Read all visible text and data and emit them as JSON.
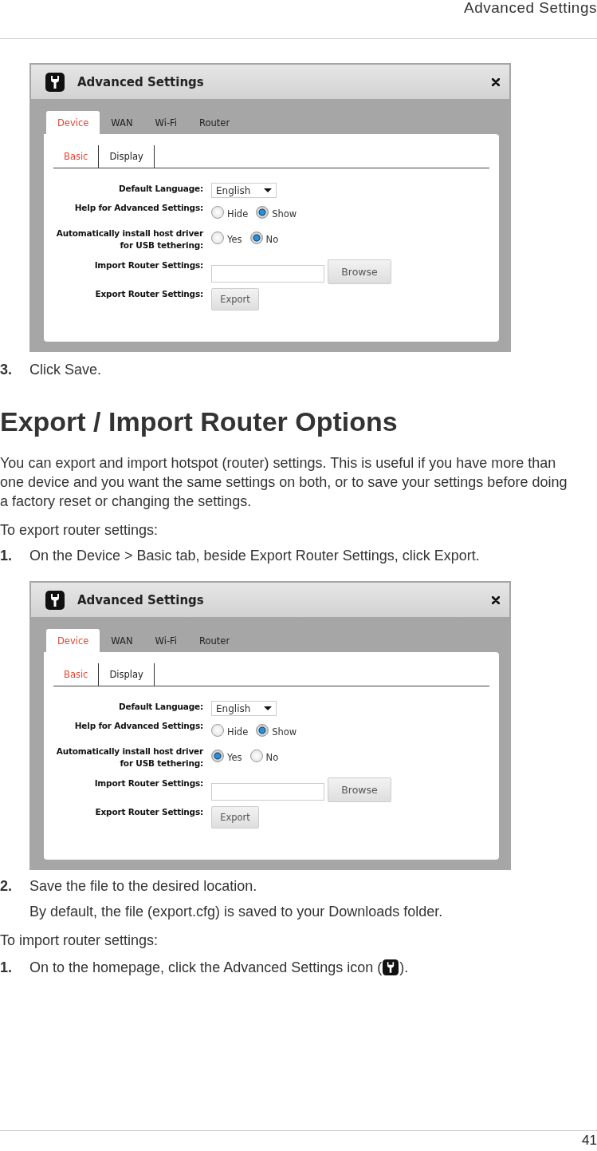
{
  "header": {
    "title": "Advanced Settings"
  },
  "content": [
    {
      "kind": "screenshot",
      "title": "Advanced Settings",
      "tabs": [
        {
          "label": "Device",
          "selected": true
        },
        {
          "label": "WAN",
          "selected": false
        },
        {
          "label": "Wi-Fi",
          "selected": false
        },
        {
          "label": "Router",
          "selected": false
        }
      ],
      "subtabs": [
        {
          "label": "Basic",
          "selected": true
        },
        {
          "label": "Display",
          "selected": false
        }
      ],
      "fields": [
        {
          "kind": "select",
          "label": "Default Language:",
          "value": "English"
        },
        {
          "kind": "radio",
          "label": "Help for Advanced Settings:",
          "options": [
            {
              "label": "Hide",
              "selected": false
            },
            {
              "label": "Show",
              "selected": true
            }
          ]
        },
        {
          "kind": "radio",
          "label": "Automatically install host driver\nfor USB tethering:",
          "options": [
            {
              "label": "Yes",
              "selected": false
            },
            {
              "label": "No",
              "selected": true
            }
          ]
        },
        {
          "kind": "file",
          "label": "Import Router Settings:",
          "button": "Browse"
        },
        {
          "kind": "button",
          "label": "Export Router Settings:",
          "button": "Export"
        }
      ]
    },
    {
      "kind": "step",
      "number": "3.",
      "text": [
        "Click Save."
      ]
    },
    {
      "kind": "heading",
      "text": "Export / Import Router Options"
    },
    {
      "kind": "paragraph",
      "text": "You can export and import hotspot (router) settings. This is useful if you have more than one device and you want the same settings on both, or to save your settings before doing a factory reset or changing the settings."
    },
    {
      "kind": "paragraph",
      "text": "To export router settings:"
    },
    {
      "kind": "step",
      "number": "1.",
      "text": [
        "On the Device > Basic tab, beside Export Router Settings, click Export."
      ]
    },
    {
      "kind": "screenshot",
      "title": "Advanced Settings",
      "tabs": [
        {
          "label": "Device",
          "selected": true
        },
        {
          "label": "WAN",
          "selected": false
        },
        {
          "label": "Wi-Fi",
          "selected": false
        },
        {
          "label": "Router",
          "selected": false
        }
      ],
      "subtabs": [
        {
          "label": "Basic",
          "selected": true
        },
        {
          "label": "Display",
          "selected": false
        }
      ],
      "fields": [
        {
          "kind": "select",
          "label": "Default Language:",
          "value": "English"
        },
        {
          "kind": "radio",
          "label": "Help for Advanced Settings:",
          "options": [
            {
              "label": "Hide",
              "selected": false
            },
            {
              "label": "Show",
              "selected": true
            }
          ]
        },
        {
          "kind": "radio",
          "label": "Automatically install host driver\nfor USB tethering:",
          "options": [
            {
              "label": "Yes",
              "selected": true
            },
            {
              "label": "No",
              "selected": false
            }
          ]
        },
        {
          "kind": "file",
          "label": "Import Router Settings:",
          "button": "Browse"
        },
        {
          "kind": "button",
          "label": "Export Router Settings:",
          "button": "Export"
        }
      ]
    },
    {
      "kind": "step",
      "number": "2.",
      "text": [
        "Save the file to the desired location."
      ],
      "note": "By default, the file (export.cfg) is saved to your Downloads folder."
    },
    {
      "kind": "paragraph",
      "text": "To import router settings:"
    },
    {
      "kind": "step",
      "number": "1.",
      "text": [
        "On to the homepage, click the Advanced Settings icon (",
        ")."
      ]
    }
  ],
  "footer": {
    "page_number": "41"
  }
}
